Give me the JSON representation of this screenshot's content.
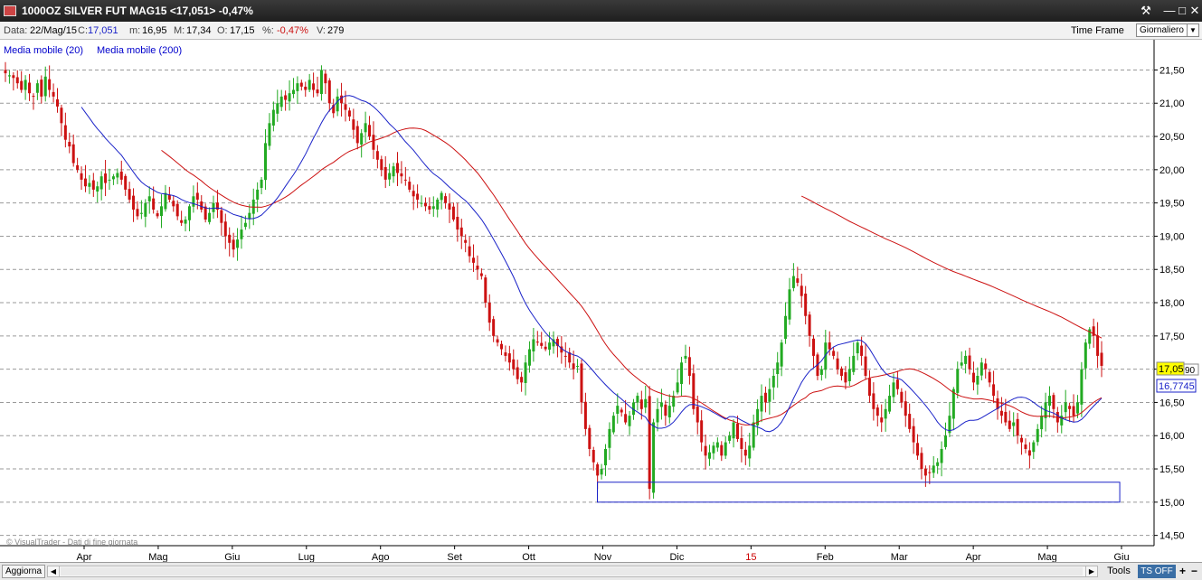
{
  "window": {
    "title": "1000OZ SILVER FUT MAG15 <17,051> -0,47%",
    "buttons": {
      "tool": "⚒",
      "minimize": "—",
      "maximize": "□",
      "close": "✕"
    }
  },
  "info_bar": {
    "date_label": "Data:",
    "date_value": "22/Mag/15",
    "close_label": "C:",
    "close_value": "17,051",
    "min_label": "m:",
    "min_value": "16,95",
    "max_label": "M:",
    "max_value": "17,34",
    "open_label": "O:",
    "open_value": "17,15",
    "pct_label": "%:",
    "pct_value": "-0,47%",
    "vol_label": "V:",
    "vol_value": "279",
    "time_frame_label": "Time Frame",
    "time_frame_value": "Giornaliero"
  },
  "legend": [
    {
      "label": "Media mobile (20)",
      "color": "#0000cc"
    },
    {
      "label": "Media mobile (200)",
      "color": "#0000cc"
    }
  ],
  "watermark": "© VisualTrader - Dati di fine giornata",
  "bottom_bar": {
    "refresh": "Aggiorna",
    "tools": "Tools",
    "ts": "TS OFF",
    "plus": "+",
    "minus": "−"
  },
  "colors": {
    "up": "#22aa22",
    "down": "#cc1111",
    "ma20": "#1a22c8",
    "ma200": "#cc1111",
    "grid": "#9a9a9a",
    "price_tag": "#ffff00",
    "rect": "#1a22c8"
  },
  "chart_data": {
    "type": "candlestick",
    "y_ticks": [
      "21,50",
      "21,00",
      "20,50",
      "20,00",
      "19,50",
      "19,00",
      "18,50",
      "18,00",
      "17,50",
      "17,00",
      "16,50",
      "16,00",
      "15,50",
      "15,00",
      "14,50"
    ],
    "y_range": [
      14.4,
      21.9
    ],
    "x_ticks": [
      "Apr",
      "Mag",
      "Giu",
      "Lug",
      "Ago",
      "Set",
      "Ott",
      "Nov",
      "Dic",
      "15",
      "Feb",
      "Mar",
      "Apr",
      "Mag",
      "Giu"
    ],
    "x_tick_colors": [
      "#000000",
      "#000000",
      "#000000",
      "#000000",
      "#000000",
      "#000000",
      "#000000",
      "#000000",
      "#000000",
      "#cc0000",
      "#000000",
      "#000000",
      "#000000",
      "#000000",
      "#000000"
    ],
    "last_price": "17,05",
    "last_price_suffix": "90",
    "ma20_value": "16,7745",
    "support_zone": {
      "low": 15.0,
      "high": 15.3,
      "from": "Nov",
      "to": "Mag"
    },
    "close_series": [
      21.45,
      21.42,
      21.38,
      21.3,
      21.2,
      21.35,
      21.15,
      21.1,
      21.3,
      21.1,
      21.4,
      21.2,
      21.1,
      20.95,
      20.7,
      20.45,
      20.35,
      20.1,
      20.0,
      19.85,
      19.75,
      19.8,
      19.7,
      19.75,
      19.9,
      19.8,
      19.85,
      19.9,
      19.95,
      19.85,
      19.7,
      19.55,
      19.4,
      19.3,
      19.35,
      19.5,
      19.6,
      19.4,
      19.3,
      19.45,
      19.65,
      19.55,
      19.45,
      19.3,
      19.2,
      19.25,
      19.45,
      19.6,
      19.55,
      19.4,
      19.25,
      19.35,
      19.5,
      19.4,
      19.2,
      19.0,
      18.9,
      18.8,
      18.95,
      19.1,
      19.2,
      19.35,
      19.55,
      19.7,
      19.85,
      20.4,
      20.7,
      20.9,
      21.0,
      21.1,
      21.05,
      21.15,
      21.2,
      21.3,
      21.25,
      21.2,
      21.35,
      21.2,
      21.15,
      21.5,
      21.3,
      21.0,
      20.85,
      21.1,
      21.0,
      20.9,
      20.8,
      20.6,
      20.4,
      20.55,
      20.7,
      20.5,
      20.3,
      20.15,
      20.0,
      19.85,
      19.95,
      20.05,
      19.95,
      19.9,
      19.85,
      19.7,
      19.6,
      19.55,
      19.5,
      19.45,
      19.4,
      19.45,
      19.55,
      19.65,
      19.5,
      19.4,
      19.25,
      19.1,
      19.0,
      18.9,
      18.7,
      18.6,
      18.5,
      18.4,
      18.0,
      17.7,
      17.5,
      17.4,
      17.3,
      17.2,
      17.1,
      17.0,
      16.85,
      16.8,
      17.1,
      17.3,
      17.45,
      17.4,
      17.35,
      17.3,
      17.4,
      17.45,
      17.35,
      17.25,
      17.2,
      17.1,
      17.0,
      17.05,
      16.5,
      16.1,
      15.8,
      15.6,
      15.4,
      15.5,
      15.8,
      16.1,
      16.3,
      16.45,
      16.35,
      16.2,
      16.3,
      16.5,
      16.6,
      16.4,
      16.55,
      15.2,
      16.2,
      16.4,
      16.5,
      16.3,
      16.45,
      16.6,
      16.8,
      17.1,
      17.2,
      16.9,
      16.4,
      16.2,
      15.9,
      15.7,
      15.75,
      15.85,
      15.9,
      15.7,
      15.9,
      16.0,
      16.2,
      15.95,
      15.8,
      15.7,
      15.85,
      16.2,
      16.4,
      16.6,
      16.5,
      16.7,
      16.9,
      17.1,
      17.4,
      17.8,
      18.2,
      18.4,
      18.3,
      18.1,
      17.8,
      17.5,
      17.2,
      16.9,
      17.0,
      17.4,
      17.3,
      17.2,
      17.0,
      16.9,
      16.8,
      17.0,
      17.2,
      17.4,
      17.2,
      16.9,
      16.6,
      16.4,
      16.3,
      16.2,
      16.4,
      16.6,
      16.8,
      16.7,
      16.5,
      16.3,
      16.1,
      15.9,
      15.7,
      15.5,
      15.4,
      15.45,
      15.55,
      15.6,
      15.8,
      16.0,
      16.3,
      16.7,
      17.0,
      17.1,
      17.2,
      17.0,
      16.8,
      16.9,
      17.1,
      17.0,
      16.8,
      16.6,
      16.4,
      16.3,
      16.2,
      16.1,
      16.2,
      16.0,
      15.9,
      15.8,
      15.7,
      15.9,
      16.1,
      16.3,
      16.5,
      16.6,
      16.4,
      16.2,
      16.3,
      16.5,
      16.4,
      16.3,
      16.5,
      17.0,
      17.4,
      17.6,
      17.5,
      17.2,
      17.05
    ],
    "series": [
      {
        "name": "Media mobile (20)",
        "values": []
      },
      {
        "name": "Media mobile (200)",
        "values": []
      }
    ]
  }
}
